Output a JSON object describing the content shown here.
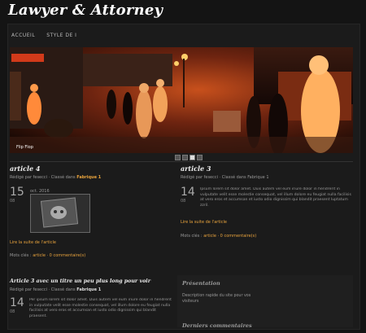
{
  "site": {
    "title": "Lawyer & Attorney"
  },
  "nav": {
    "items": [
      {
        "label": "ACCUEIL"
      },
      {
        "label": "STYLE DE I"
      }
    ]
  },
  "hero": {
    "caption": "Flip Flop",
    "slides": 4,
    "active_slide": 3
  },
  "articles": [
    {
      "title": "article 4",
      "meta_prefix": "Rédigé par fesecci · Classé dans",
      "category": "Fabrique 1",
      "day": "15",
      "month": "08",
      "tag": "oct. 2016",
      "more": "Lire la suite de l'article",
      "footer_prefix": "Mots clés :",
      "footer_links": "article · 0 commentaire(s)"
    },
    {
      "title": "article 3",
      "meta_prefix": "Rédigé par fesecci · Classé dans",
      "category": "Fabrique 1",
      "day": "14",
      "month": "08",
      "body": "Ipsum lorem sit dolor amet. Duis autem vel eum iriure dolor in hendrerit in vulputate velit esse molestie consequat, vel illum dolore eu feugiat nulla facilisis at vero eros et accumsan et iusto odio dignissim qui blandit praesent luptatum zzril.",
      "more": "Lire la suite de l'article",
      "footer_prefix": "Mots clés :",
      "footer_links": "article · 0 commentaire(s)"
    },
    {
      "title": "Article 3 avec un titre un peu plus long pour voir",
      "meta_prefix": "Rédigé par fesecci · Classé dans",
      "category": "Fabrique 1",
      "day": "14",
      "month": "08",
      "body": "Per ipsum lorem sit dolor amet. Duis autem vel eum iriure dolor in hendrerit in vulputate velit esse molestie consequat, vel illum dolore eu feugiat nulla facilisis at vero eros et accumsan et iusto odio dignissim qui blandit praesent."
    }
  ],
  "sidebar": {
    "presentation_title": "Présentation",
    "presentation_text": "Description rapide du site pour vos visiteurs",
    "comments_title": "Derniers commentaires"
  }
}
